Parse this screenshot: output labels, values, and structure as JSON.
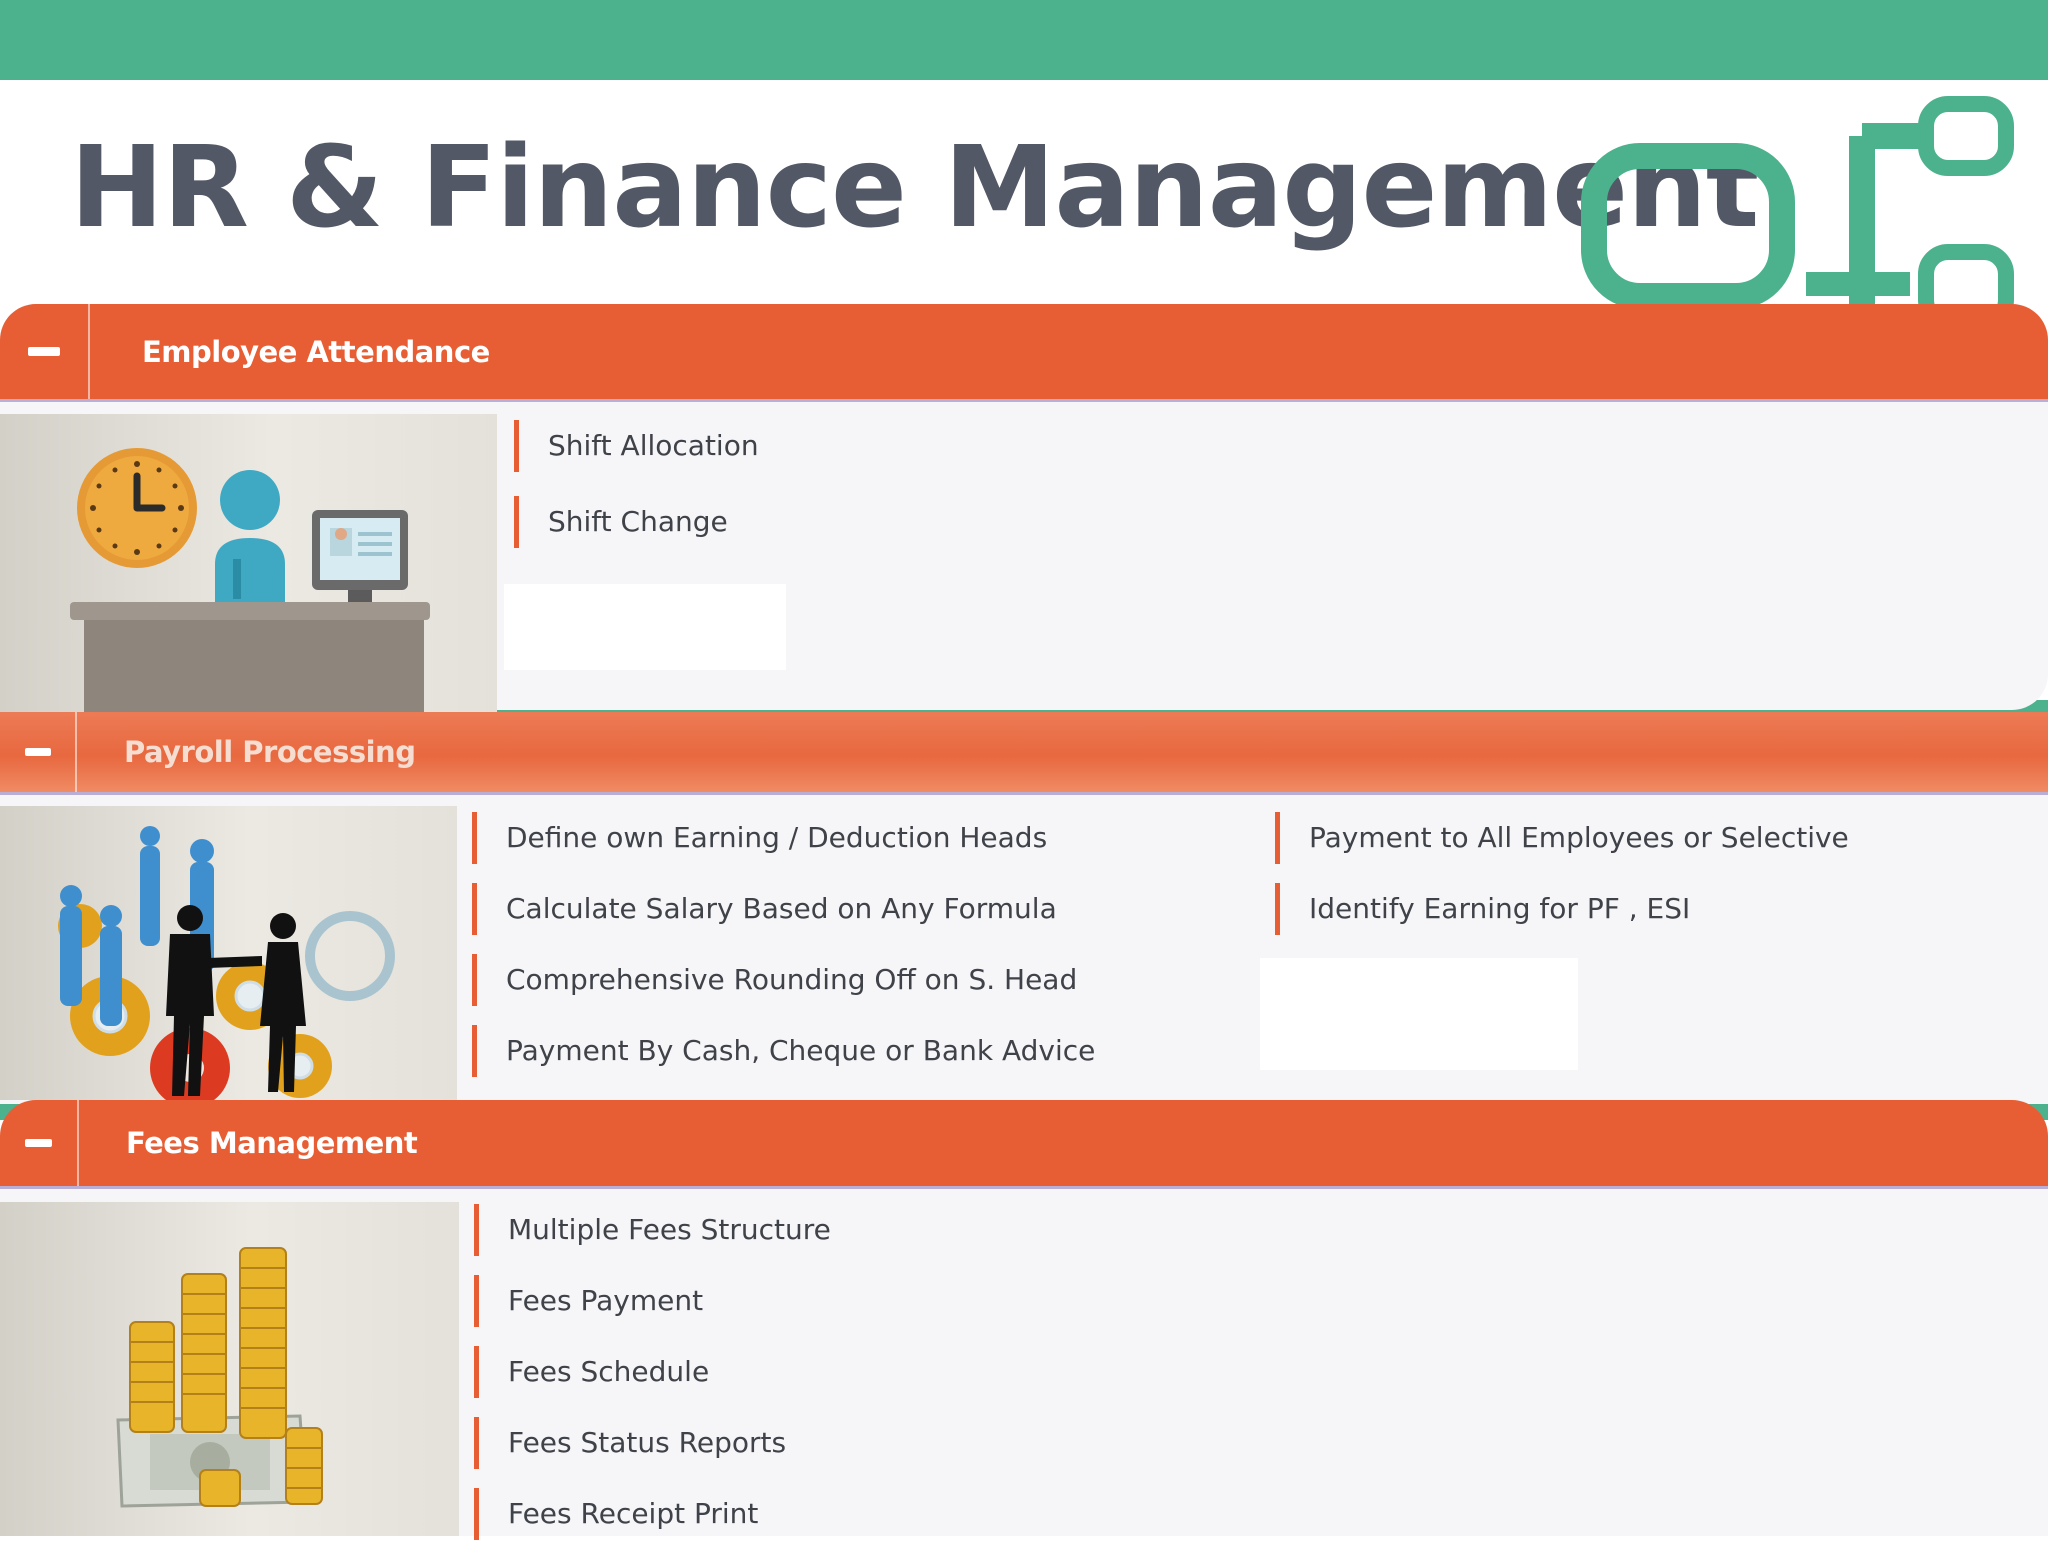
{
  "slide": {
    "title": "HR & Finance Management",
    "title_colon": ":"
  },
  "colors": {
    "band": "#4cb28d",
    "header": "#e75e34",
    "title_text": "#525865",
    "body_bg": "#f6f6f8"
  },
  "sections": [
    {
      "title": "Employee Attendance",
      "collapse_icon": "minus-icon",
      "image": "clock-desk-computer-illustration",
      "items": [
        "Shift Allocation",
        "Shift Change"
      ]
    },
    {
      "title": "Payroll Processing",
      "collapse_icon": "minus-icon",
      "image": "handshake-gears-illustration",
      "items_left": [
        "Define own Earning / Deduction Heads",
        "Calculate Salary Based on Any Formula",
        "Comprehensive Rounding Off on S. Head",
        "Payment By Cash, Cheque or Bank Advice"
      ],
      "items_right": [
        "Payment to All Employees or Selective",
        "Identify Earning for PF , ESI"
      ]
    },
    {
      "title": "Fees Management",
      "collapse_icon": "minus-icon",
      "image": "coin-stacks-illustration",
      "items": [
        "Multiple Fees Structure",
        "Fees Payment",
        "Fees Schedule",
        "Fees Status Reports",
        "Fees Receipt Print"
      ]
    }
  ]
}
